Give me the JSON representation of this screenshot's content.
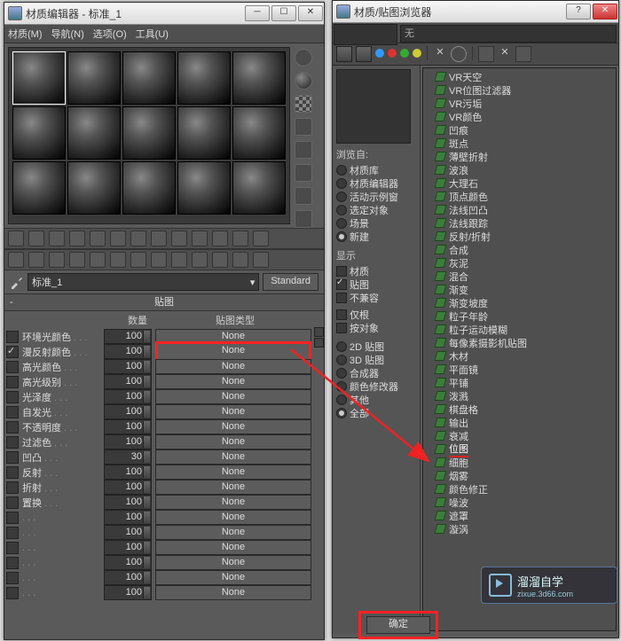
{
  "left": {
    "title": "材质编辑器 - 标准_1",
    "menu": [
      "材质(M)",
      "导航(N)",
      "选项(O)",
      "工具(U)"
    ],
    "material_name": "标准_1",
    "type_button": "Standard",
    "rollout": "贴图",
    "col_amount": "数量",
    "col_type": "贴图类型",
    "rows": [
      {
        "label": "环境光颜色",
        "amount": "100",
        "map": "None",
        "checked": false
      },
      {
        "label": "漫反射颜色",
        "amount": "100",
        "map": "None",
        "checked": true,
        "hl": true
      },
      {
        "label": "高光颜色",
        "amount": "100",
        "map": "None",
        "checked": false
      },
      {
        "label": "高光级别",
        "amount": "100",
        "map": "None",
        "checked": false
      },
      {
        "label": "光泽度",
        "amount": "100",
        "map": "None",
        "checked": false
      },
      {
        "label": "自发光",
        "amount": "100",
        "map": "None",
        "checked": false
      },
      {
        "label": "不透明度",
        "amount": "100",
        "map": "None",
        "checked": false
      },
      {
        "label": "过滤色",
        "amount": "100",
        "map": "None",
        "checked": false
      },
      {
        "label": "凹凸",
        "amount": "30",
        "map": "None",
        "checked": false
      },
      {
        "label": "反射",
        "amount": "100",
        "map": "None",
        "checked": false
      },
      {
        "label": "折射",
        "amount": "100",
        "map": "None",
        "checked": false
      },
      {
        "label": "置换",
        "amount": "100",
        "map": "None",
        "checked": false
      },
      {
        "label": "",
        "amount": "100",
        "map": "None",
        "checked": false
      },
      {
        "label": "",
        "amount": "100",
        "map": "None",
        "checked": false
      },
      {
        "label": "",
        "amount": "100",
        "map": "None",
        "checked": false
      },
      {
        "label": "",
        "amount": "100",
        "map": "None",
        "checked": false
      },
      {
        "label": "",
        "amount": "100",
        "map": "None",
        "checked": false
      },
      {
        "label": "",
        "amount": "100",
        "map": "None",
        "checked": false
      }
    ]
  },
  "right": {
    "title": "材质/贴图浏览器",
    "name_field": "无",
    "browse": {
      "title": "浏览自:",
      "opts": [
        {
          "label": "材质库",
          "on": false
        },
        {
          "label": "材质编辑器",
          "on": false
        },
        {
          "label": "活动示例窗",
          "on": false
        },
        {
          "label": "选定对象",
          "on": false
        },
        {
          "label": "场景",
          "on": false
        },
        {
          "label": "新建",
          "on": true
        }
      ]
    },
    "show": {
      "title": "显示",
      "opts": [
        {
          "label": "材质",
          "on": false
        },
        {
          "label": "贴图",
          "on": true
        },
        {
          "label": "不兼容",
          "on": false
        }
      ],
      "opts2": [
        {
          "label": "仅根",
          "on": false
        },
        {
          "label": "按对象",
          "on": false
        }
      ]
    },
    "cat": {
      "opts": [
        {
          "label": "2D 贴图",
          "on": false
        },
        {
          "label": "3D 贴图",
          "on": false
        },
        {
          "label": "合成器",
          "on": false
        },
        {
          "label": "颜色修改器",
          "on": false
        },
        {
          "label": "其他",
          "on": false
        },
        {
          "label": "全部",
          "on": true
        }
      ]
    },
    "tree": [
      "VR天空",
      "VR位图过滤器",
      "VR污垢",
      "VR颜色",
      "凹痕",
      "斑点",
      "薄壁折射",
      "波浪",
      "大理石",
      "顶点颜色",
      "法线凹凸",
      "法线跟踪",
      "反射/折射",
      "合成",
      "灰泥",
      "混合",
      "渐变",
      "渐变坡度",
      "粒子年龄",
      "粒子运动模糊",
      "每像素摄影机贴图",
      "木材",
      "平面镜",
      "平铺",
      "泼溅",
      "棋盘格",
      "输出",
      "衰减",
      "位图",
      "细胞",
      "烟雾",
      "颜色修正",
      "噪波",
      "遮罩",
      "漩涡"
    ],
    "tree_hl_index": 28,
    "ok": "确定"
  },
  "wm": {
    "brand": "溜溜自学",
    "url": "zixue.3d66.com"
  }
}
